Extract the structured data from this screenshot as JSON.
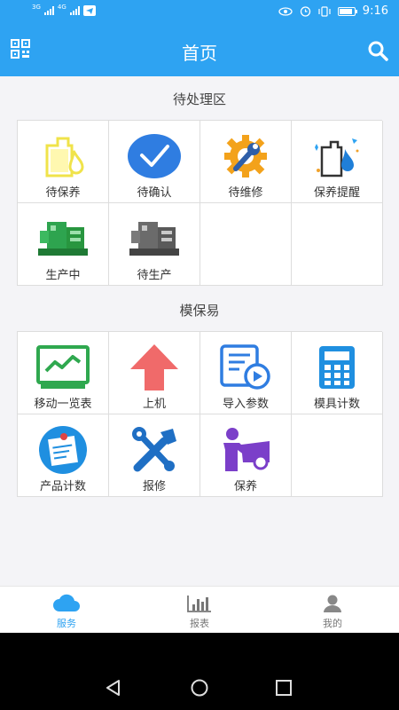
{
  "status_bar": {
    "network_1": "3G",
    "network_2": "4G",
    "time": "9:16"
  },
  "header": {
    "title": "首页",
    "left_icon": "qr-scan-icon",
    "right_icon": "search-icon"
  },
  "sections": [
    {
      "title": "待处理区",
      "items": [
        {
          "label": "待保养",
          "icon": "oil-bottle-icon"
        },
        {
          "label": "待确认",
          "icon": "checkmark-circle-icon"
        },
        {
          "label": "待维修",
          "icon": "gear-wrench-icon"
        },
        {
          "label": "保养提醒",
          "icon": "oil-drop-reminder-icon"
        },
        {
          "label": "生产中",
          "icon": "machine-green-icon"
        },
        {
          "label": "待生产",
          "icon": "machine-gray-icon"
        }
      ]
    },
    {
      "title": "模保易",
      "items": [
        {
          "label": "移动一览表",
          "icon": "monitor-chart-icon"
        },
        {
          "label": "上机",
          "icon": "up-arrow-icon"
        },
        {
          "label": "导入参数",
          "icon": "import-doc-icon"
        },
        {
          "label": "模具计数",
          "icon": "calculator-icon"
        },
        {
          "label": "产品计数",
          "icon": "clipboard-pin-icon"
        },
        {
          "label": "报修",
          "icon": "tools-icon"
        },
        {
          "label": "保养",
          "icon": "mechanic-car-icon"
        }
      ]
    }
  ],
  "tabs": [
    {
      "label": "服务",
      "icon": "cloud-icon",
      "active": true
    },
    {
      "label": "报表",
      "icon": "bar-chart-icon",
      "active": false
    },
    {
      "label": "我的",
      "icon": "user-icon",
      "active": false
    }
  ],
  "colors": {
    "accent": "#2ea3f2",
    "background": "#f4f4f7"
  }
}
